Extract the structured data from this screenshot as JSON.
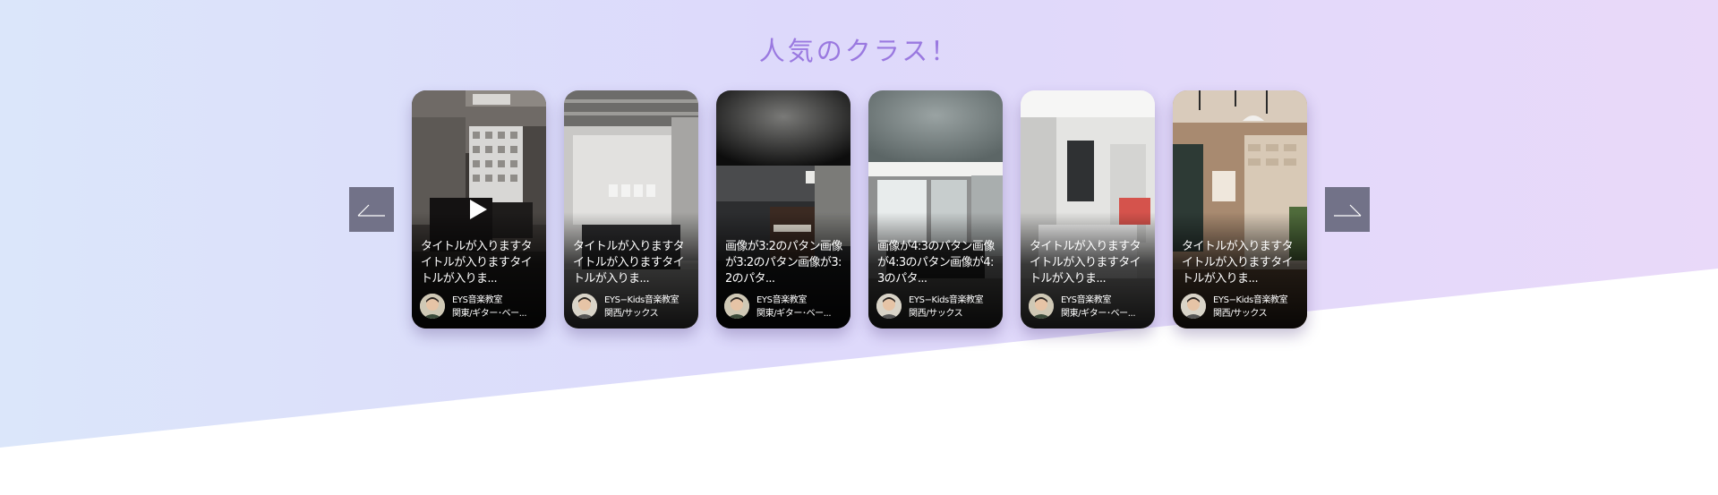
{
  "section": {
    "title": "人気のクラス！"
  },
  "carousel": {
    "prev_icon": "arrow-left-icon",
    "next_icon": "arrow-right-icon",
    "cards": [
      {
        "title": "タイトルが入りますタイトルが入りますタイトルが入りま...",
        "school": "EYS音楽教室",
        "area": "関東/ギター･ベー...",
        "has_video": true,
        "photo": "piano-room"
      },
      {
        "title": "タイトルが入りますタイトルが入りますタイトルが入りま...",
        "school": "EYS−Kids音楽教室",
        "area": "関西/サックス",
        "has_video": false,
        "photo": "glass-studio"
      },
      {
        "title": "画像が3:2のパタン画像が3:2のパタン画像が3:2のパタ...",
        "school": "EYS音楽教室",
        "area": "関東/ギター･ベー...",
        "has_video": false,
        "photo": "piano-booth"
      },
      {
        "title": "画像が4:3のパタン画像が4:3のパタン画像が4:3のパタ...",
        "school": "EYS−Kids音楽教室",
        "area": "関西/サックス",
        "has_video": false,
        "photo": "lounge"
      },
      {
        "title": "タイトルが入りますタイトルが入りますタイトルが入りま...",
        "school": "EYS音楽教室",
        "area": "関東/ギター･ベー...",
        "has_video": false,
        "photo": "white-room"
      },
      {
        "title": "タイトルが入りますタイトルが入りますタイトルが入りま...",
        "school": "EYS−Kids音楽教室",
        "area": "関西/サックス",
        "has_video": false,
        "photo": "cafe-studio"
      }
    ]
  }
}
